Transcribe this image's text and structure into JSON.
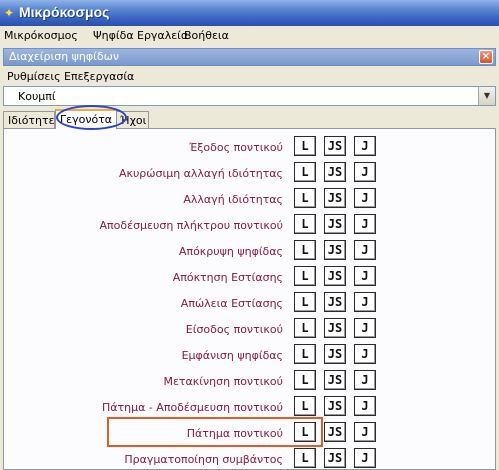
{
  "window": {
    "title": "Μικρόκοσμος"
  },
  "menubar": [
    "Μικρόκοσμος",
    "Ψηφίδα",
    "Εργαλεία",
    "Βοήθεια"
  ],
  "panel": {
    "title": "Διαχείριση ψηφίδων",
    "close_label": "×",
    "submenu": [
      "Ρυθμίσεις",
      "Επεξεργασία"
    ],
    "selected_object": "Κουμπί"
  },
  "tabs": [
    "Ιδιότητες",
    "Γεγονότα",
    "Ήχοι"
  ],
  "active_tab": "Γεγονότα",
  "events": [
    "Έξοδος ποντικού",
    "Ακυρώσιμη αλλαγή ιδιότητας",
    "Αλλαγή ιδιότητας",
    "Αποδέσμευση πλήκτρου ποντικού",
    "Απόκρυψη ψηφίδας",
    "Απόκτηση Εστίασης",
    "Απώλεια Εστίασης",
    "Είσοδος ποντικού",
    "Εμφάνιση ψηφίδας",
    "Μετακίνηση ποντικού",
    "Πάτημα - Αποδέσμευση ποντικού",
    "Πάτημα ποντικού",
    "Πραγματοποίηση συμβάντος"
  ],
  "event_buttons": [
    "L",
    "JS",
    "J"
  ],
  "highlighted_event": "Πάτημα ποντικού",
  "colors": {
    "event_text": "#8b1a3c",
    "tab_circle": "#2c45c8",
    "row_box": "#e25b2a"
  }
}
